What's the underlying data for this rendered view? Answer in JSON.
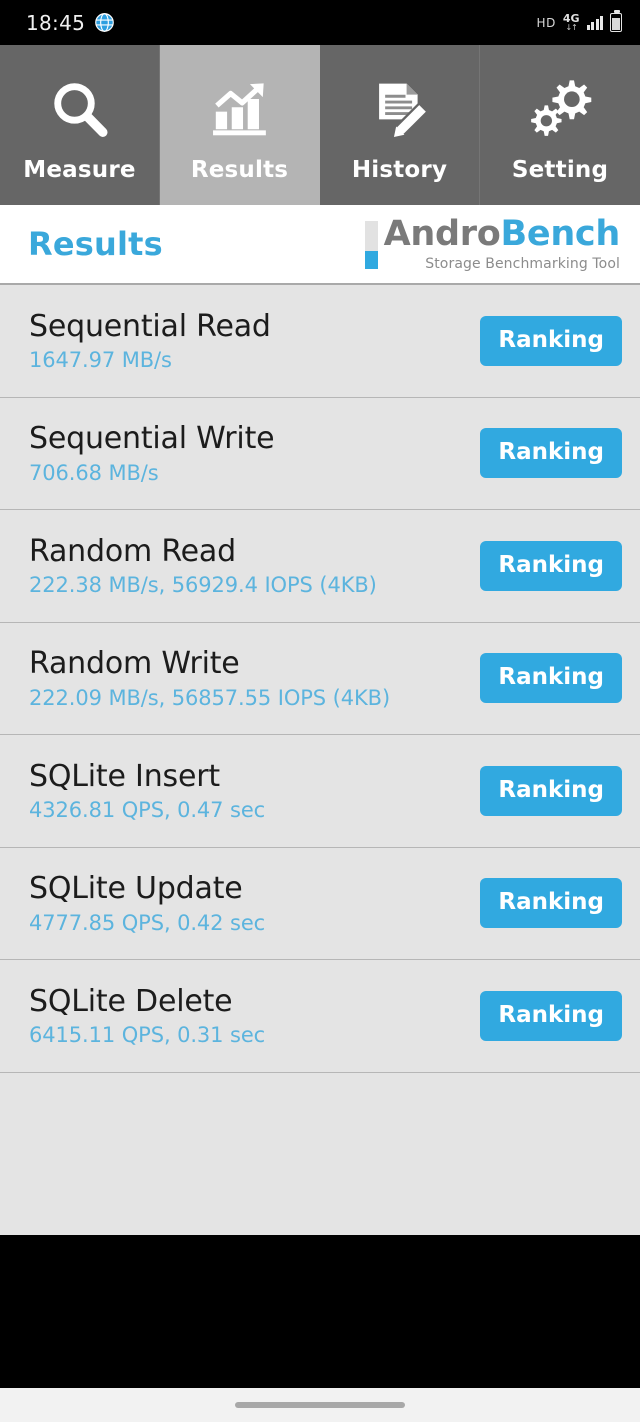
{
  "statusbar": {
    "time": "18:45",
    "globe_icon": "globe-icon",
    "hd_label": "HD",
    "network_label": "4G",
    "data_arrows": "↓↑",
    "signal_icon": "signal-bars-icon",
    "battery_icon": "battery-icon"
  },
  "tabs": [
    {
      "label": "Measure",
      "icon": "magnifier-icon",
      "active": false
    },
    {
      "label": "Results",
      "icon": "bar-chart-icon",
      "active": true
    },
    {
      "label": "History",
      "icon": "document-pencil-icon",
      "active": false
    },
    {
      "label": "Setting",
      "icon": "gears-icon",
      "active": false
    }
  ],
  "header": {
    "title": "Results",
    "logo_primary": "Andro",
    "logo_secondary": "Bench",
    "logo_tagline": "Storage Benchmarking Tool"
  },
  "results": [
    {
      "name": "Sequential Read",
      "value": "1647.97 MB/s",
      "button": "Ranking"
    },
    {
      "name": "Sequential Write",
      "value": "706.68 MB/s",
      "button": "Ranking"
    },
    {
      "name": "Random Read",
      "value": "222.38 MB/s, 56929.4 IOPS (4KB)",
      "button": "Ranking"
    },
    {
      "name": "Random Write",
      "value": "222.09 MB/s, 56857.55 IOPS (4KB)",
      "button": "Ranking"
    },
    {
      "name": "SQLite Insert",
      "value": "4326.81 QPS, 0.47 sec",
      "button": "Ranking"
    },
    {
      "name": "SQLite Update",
      "value": "4777.85 QPS, 0.42 sec",
      "button": "Ranking"
    },
    {
      "name": "SQLite Delete",
      "value": "6415.11 QPS, 0.31 sec",
      "button": "Ranking"
    }
  ],
  "navbar": {
    "home_pill": "home-gesture-pill"
  },
  "colors": {
    "accent_blue": "#31a9e0",
    "value_blue": "#5cb4de",
    "title_blue": "#3aa8db",
    "tab_inactive": "#666666",
    "tab_active": "#b4b4b4",
    "list_background": "#e4e4e4",
    "logo_gray": "#7a7a7a"
  }
}
